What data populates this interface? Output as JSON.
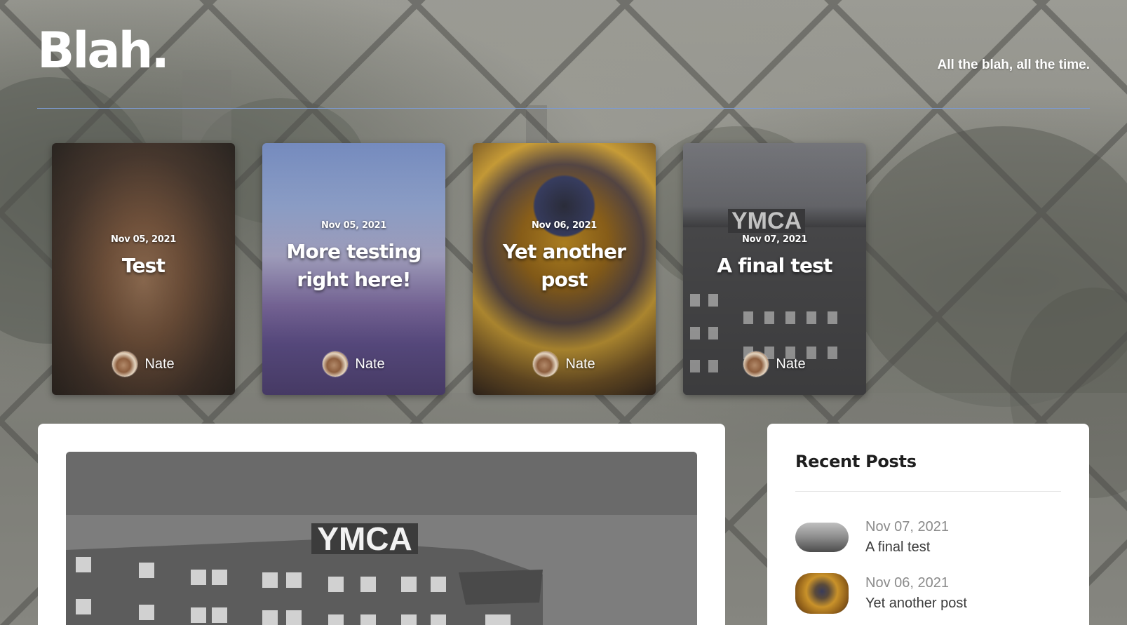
{
  "site": {
    "title": "Blah.",
    "tagline": "All the blah, all the time."
  },
  "featured": [
    {
      "date": "Nov 05, 2021",
      "title": "Test",
      "author": "Nate"
    },
    {
      "date": "Nov 05, 2021",
      "title": "More testing right here!",
      "author": "Nate"
    },
    {
      "date": "Nov 06, 2021",
      "title": "Yet another post",
      "author": "Nate"
    },
    {
      "date": "Nov 07, 2021",
      "title": "A final test",
      "author": "Nate"
    }
  ],
  "hero_image_text": "YMCA",
  "sidebar": {
    "heading": "Recent Posts",
    "items": [
      {
        "date": "Nov 07, 2021",
        "title": "A final test"
      },
      {
        "date": "Nov 06, 2021",
        "title": "Yet another post"
      }
    ]
  },
  "colors": {
    "header_rule": "#7d9bd1",
    "panel_bg": "#ffffff",
    "title_text": "#ffffff"
  }
}
